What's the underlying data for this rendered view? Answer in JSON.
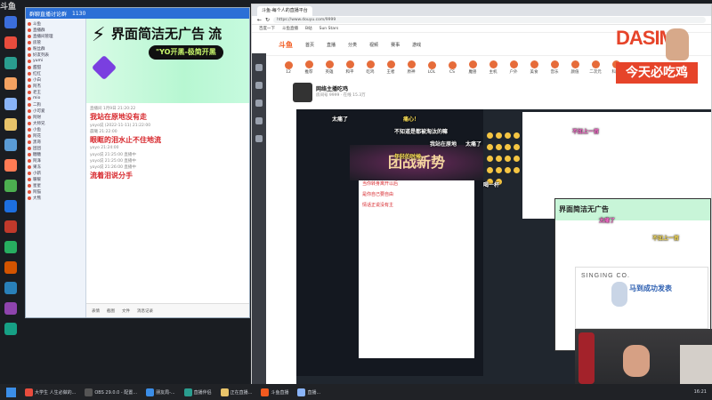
{
  "corner_logo": "斗鱼",
  "taskbar": {
    "items": [
      "大学生 人生必做的...",
      "OBS 29.0.0 - 配置...",
      "朋友局-...",
      "直播伴侣",
      "正在直播...",
      "斗鱼直播",
      "直播..."
    ],
    "time": "16:21"
  },
  "chat": {
    "window_title": "群聊直播讨论群",
    "count": "1130",
    "tree": [
      "斗鱼",
      "直播群",
      "直播间管理",
      "房管",
      "粉丝群",
      "好友列表",
      "yumi",
      "甜甜",
      "红红",
      "小白",
      "阿杰",
      "老王",
      "mio",
      "二狗",
      "小可爱",
      "阿财",
      "大师兄",
      "小鱼",
      "阿花",
      "黑哥",
      "团团",
      "糖糖",
      "阿泽",
      "果冻",
      "小新",
      "暖暖",
      "星星",
      "阿猫",
      "大熊"
    ],
    "ad_title": "界面简洁无广告 流",
    "ad_subtitle": "\"YO开黑-极简开黑",
    "messages": [
      {
        "meta": "直播间 1月9日 21:20:22",
        "text": ""
      },
      {
        "meta": "",
        "text": "我站在原地没有走"
      },
      {
        "meta": "yoyo说 (2022-11-11) 21:22:00",
        "text": ""
      },
      {
        "meta": "晨曦 21:22:00",
        "text": ""
      },
      {
        "meta": "",
        "text": "眼眶的泪水止不住地流"
      },
      {
        "meta": "yoyo 21:24:00",
        "text": ""
      },
      {
        "meta": "yoyo说 21:25:00 直播中",
        "text": ""
      },
      {
        "meta": "yoyo说 21:25:00 直播中",
        "text": ""
      },
      {
        "meta": "yoyo说 21:26:00 直播中",
        "text": ""
      },
      {
        "meta": "",
        "text": "流着泪说分手"
      }
    ],
    "toolbar": [
      "表情",
      "截图",
      "文件",
      "消息记录"
    ]
  },
  "browser": {
    "tab": "斗鱼-每个人的直播平台",
    "url": "https://www.douyu.com/9999",
    "bookmarks": [
      "百度一下",
      "斗鱼直播",
      "B站",
      "Sun Stars"
    ],
    "nav": [
      "首页",
      "直播",
      "分类",
      "视频",
      "赛事",
      "游戏"
    ],
    "categories": [
      "12",
      "推荐",
      "英雄",
      "和平",
      "吃鸡",
      "王者",
      "原神",
      "LOL",
      "CS",
      "魔兽",
      "主机",
      "户外",
      "美食",
      "音乐",
      "颜值",
      "二次元",
      "科技"
    ],
    "room_name": "网络主播吃鸡",
    "room_meta": "房间号 9999 · 在线 15.3万"
  },
  "stream": {
    "game_banner": "团战新势",
    "nested_lines": [
      "当你转身离开以后",
      "是你自己要自由",
      "情话正说没有主"
    ],
    "danmaku": [
      "太痛了",
      "痛心！",
      "不知道是都被淘汰的嘛",
      "不如上一首",
      "我站在原地",
      "太痛了",
      "年轻的时候",
      "太痛了",
      "喝一杯",
      "不如上一首"
    ],
    "inner_ad": "界面简洁无广告"
  },
  "logo": {
    "brand": "DASIMA",
    "tagline": "今天必吃鸡"
  },
  "singing": {
    "title": "SINGING CO.",
    "cn": "马到成功发表"
  }
}
